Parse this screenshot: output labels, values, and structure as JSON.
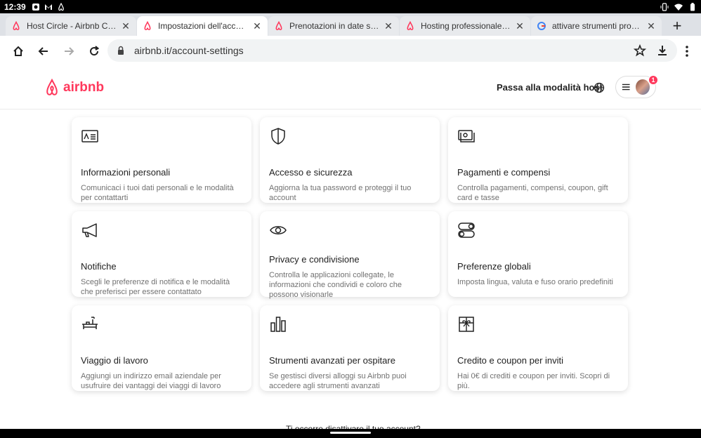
{
  "status_bar": {
    "time": "12:39"
  },
  "tabs": [
    {
      "title": "Host Circle - Airbnb Community",
      "active": false,
      "favicon": "airbnb-logo"
    },
    {
      "title": "Impostazioni dell'account - Airbnb",
      "active": true,
      "favicon": "airbnb-logo"
    },
    {
      "title": "Prenotazioni in date specifiche",
      "active": false,
      "favicon": "airbnb-logo"
    },
    {
      "title": "Hosting professionale - Impostazioni",
      "active": false,
      "favicon": "airbnb-logo"
    },
    {
      "title": "attivare strumenti professionali",
      "active": false,
      "favicon": "google-logo"
    }
  ],
  "toolbar": {
    "url": "airbnb.it/account-settings"
  },
  "header": {
    "logo_text": "airbnb",
    "host_link": "Passa alla modalità host",
    "notification_count": "1"
  },
  "cards": [
    {
      "icon": "id-card-icon",
      "title": "Informazioni personali",
      "desc": "Comunicaci i tuoi dati personali e le modalità per contattarti"
    },
    {
      "icon": "shield-icon",
      "title": "Accesso e sicurezza",
      "desc": "Aggiorna la tua password e proteggi il tuo account"
    },
    {
      "icon": "payments-icon",
      "title": "Pagamenti e compensi",
      "desc": "Controlla pagamenti, compensi, coupon, gift card e tasse"
    },
    {
      "icon": "megaphone-icon",
      "title": "Notifiche",
      "desc": "Scegli le preferenze di notifica e le modalità che preferisci per essere contattato"
    },
    {
      "icon": "eye-icon",
      "title": "Privacy e condivisione",
      "desc": "Controlla le applicazioni collegate, le informazioni che condividi e coloro che possono visionarle"
    },
    {
      "icon": "toggles-icon",
      "title": "Preferenze globali",
      "desc": "Imposta lingua, valuta e fuso orario predefiniti"
    },
    {
      "icon": "briefcase-desk-icon",
      "title": "Viaggio di lavoro",
      "desc": "Aggiungi un indirizzo email aziendale per usufruire dei vantaggi dei viaggi di lavoro"
    },
    {
      "icon": "bar-chart-icon",
      "title": "Strumenti avanzati per ospitare",
      "desc": "Se gestisci diversi alloggi su Airbnb puoi accedere agli strumenti avanzati"
    },
    {
      "icon": "gift-icon",
      "title": "Credito e coupon per inviti",
      "desc": "Hai 0€ di crediti e coupon per inviti. Scopri di più."
    }
  ],
  "footer": {
    "deactivate_text": "Ti occorre disattivare il tuo account?"
  },
  "colors": {
    "brand": "#ff385c",
    "tabbar": "#dee1e6",
    "omnibox": "#f1f3f4"
  }
}
